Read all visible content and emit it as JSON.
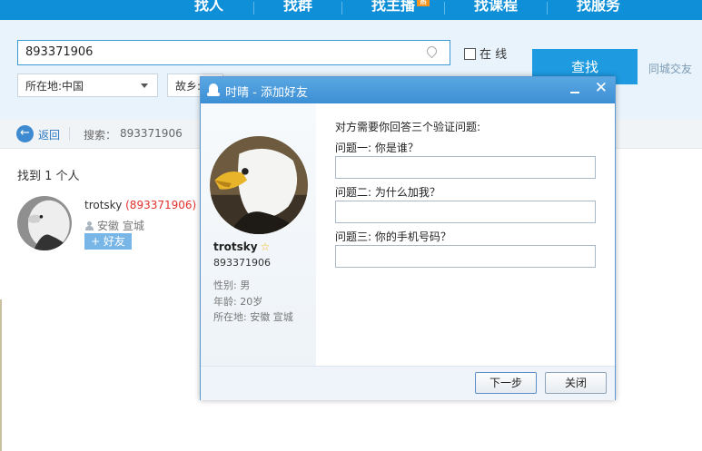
{
  "topnav": {
    "tabs": [
      "找人",
      "找群",
      "找主播",
      "找课程",
      "找服务"
    ],
    "hot_badge": "热"
  },
  "search": {
    "value": "893371906",
    "online_label": "在 线",
    "find_button": "查找",
    "city_link": "同城交友",
    "location_select": "所在地:中国",
    "hometown_select": "故乡:"
  },
  "result_bar": {
    "back": "返回",
    "search_label": "搜索：",
    "search_value": "893371906"
  },
  "results": {
    "found_text": "找到 1 个人",
    "item": {
      "name": "trotsky",
      "number": "(893371906)",
      "location": "安徽 宣城",
      "add_button": "+ 好友"
    }
  },
  "dialog": {
    "title": "时晴 - 添加好友",
    "profile": {
      "name": "trotsky",
      "number": "893371906",
      "gender": "性别: 男",
      "age": "年龄: 20岁",
      "location": "所在地: 安徽 宣城"
    },
    "intro": "对方需要你回答三个验证问题:",
    "questions": [
      {
        "label": "问题一: 你是谁？",
        "answer": ""
      },
      {
        "label": "问题二: 为什么加我？",
        "answer": ""
      },
      {
        "label": "问题三: 你的手机号码？",
        "answer": ""
      }
    ],
    "next_button": "下一步",
    "close_button": "关闭"
  },
  "colors": {
    "nav_blue": "#0e8fd7",
    "accent_blue": "#1d9ae0",
    "qq_number_red": "#e0312b"
  }
}
